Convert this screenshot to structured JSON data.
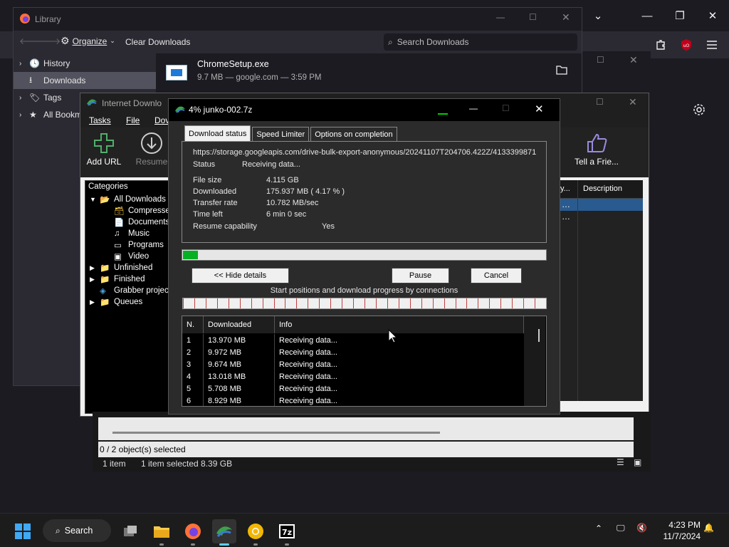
{
  "firefox": {
    "toolbar_icons": [
      "extensions-icon",
      "ublock-icon",
      "menu-icon"
    ]
  },
  "library": {
    "title": "Library",
    "toolbar": {
      "organize": "Organize",
      "clear": "Clear Downloads",
      "search_placeholder": "Search Downloads"
    },
    "sidebar": [
      {
        "label": "History",
        "icon": "clock-icon"
      },
      {
        "label": "Downloads",
        "icon": "download-icon"
      },
      {
        "label": "Tags",
        "icon": "tag-icon"
      },
      {
        "label": "All Bookm",
        "icon": "star-icon"
      }
    ],
    "download": {
      "name": "ChromeSetup.exe",
      "meta": "9.7 MB — google.com — 3:59 PM"
    }
  },
  "idm": {
    "title": "Internet Downlo",
    "menu": [
      "Tasks",
      "File",
      "Dov"
    ],
    "tools": {
      "add_url": "Add URL",
      "resume": "Resume",
      "tell": "Tell a Frie..."
    },
    "columns": {
      "prev": "y...",
      "description": "Description"
    },
    "categories": {
      "header": "Categories",
      "items": [
        {
          "label": "All Downloads",
          "level": 0
        },
        {
          "label": "Compresse",
          "level": 1
        },
        {
          "label": "Documents",
          "level": 1
        },
        {
          "label": "Music",
          "level": 1
        },
        {
          "label": "Programs",
          "level": 1
        },
        {
          "label": "Video",
          "level": 1
        },
        {
          "label": "Unfinished",
          "level": 0
        },
        {
          "label": "Finished",
          "level": 0
        },
        {
          "label": "Grabber projec",
          "level": 0
        },
        {
          "label": "Queues",
          "level": 0
        }
      ]
    }
  },
  "explorer": {
    "selection": "0 / 2 object(s) selected",
    "status_count": "1 item",
    "status_selected": "1 item selected  8.39 GB"
  },
  "dialog": {
    "title": "4% junko-002.7z",
    "tabs": [
      "Download status",
      "Speed Limiter",
      "Options on completion"
    ],
    "url": "https://storage.googleapis.com/drive-bulk-export-anonymous/20241107T204706.422Z/4133399871",
    "status_label": "Status",
    "status_value": "Receiving data...",
    "file_size_label": "File size",
    "file_size_value": "4.115  GB",
    "downloaded_label": "Downloaded",
    "downloaded_value": "175.937  MB  ( 4.17 % )",
    "rate_label": "Transfer rate",
    "rate_value": "10.782  MB/sec",
    "time_label": "Time left",
    "time_value": "6 min 0 sec",
    "resume_label": "Resume capability",
    "resume_value": "Yes",
    "progress": 0.0417,
    "buttons": {
      "hide": "<< Hide details",
      "pause": "Pause",
      "cancel": "Cancel"
    },
    "connections_label": "Start positions and download progress by connections",
    "table": {
      "headers": [
        "N.",
        "Downloaded",
        "Info"
      ],
      "rows": [
        [
          "1",
          "13.970  MB",
          "Receiving data..."
        ],
        [
          "2",
          "9.972  MB",
          "Receiving data..."
        ],
        [
          "3",
          "9.674  MB",
          "Receiving data..."
        ],
        [
          "4",
          "13.018  MB",
          "Receiving data..."
        ],
        [
          "5",
          "5.708  MB",
          "Receiving data..."
        ],
        [
          "6",
          "8.929  MB",
          "Receiving data..."
        ]
      ]
    }
  },
  "taskbar": {
    "search": "Search",
    "time": "4:23 PM",
    "date": "11/7/2024",
    "apps": [
      "task-view-icon",
      "file-explorer-icon",
      "firefox-icon",
      "idm-icon",
      "chrome-canary-icon",
      "7zip-icon"
    ]
  },
  "colors": {
    "progress_fill": "#06b025",
    "selection": "#52525e",
    "accent": "#0078d4"
  }
}
